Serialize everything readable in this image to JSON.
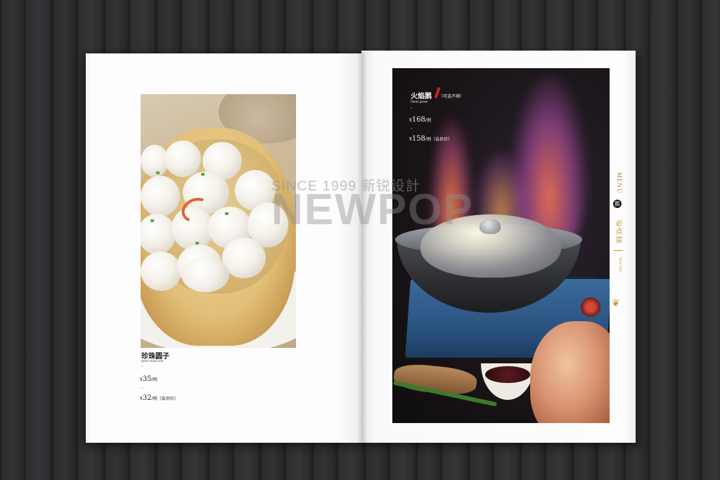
{
  "left_dish": {
    "name_cn": "珍珠圆子",
    "name_en": "pearl round son",
    "dash": "-",
    "price1_currency": "¥",
    "price1_value": "35",
    "price1_unit": "/例",
    "price2_currency": "¥",
    "price2_value": "32",
    "price2_unit": "/例（会员价）"
  },
  "right_dish": {
    "name_cn": "火焰鹅",
    "option_note": "（可选不辣）",
    "name_en": "flame goose",
    "dash": "-",
    "price1_currency": "¥",
    "price1_value": "168",
    "price1_unit": "/例",
    "price2_currency": "¥",
    "price2_value": "158",
    "price2_unit": "/例（会员价）"
  },
  "side_tab": {
    "menu": "MENU",
    "badge": "鹅",
    "title_cn": "必点菜",
    "title_en": "Must order"
  },
  "watermark": {
    "line1": "SINCE 1999 新锐设計",
    "line2": "NEWPOP"
  },
  "colors": {
    "accent_gold": "#c49a3c",
    "background_wood": "#2e2e30",
    "page": "#fdfdfd"
  }
}
